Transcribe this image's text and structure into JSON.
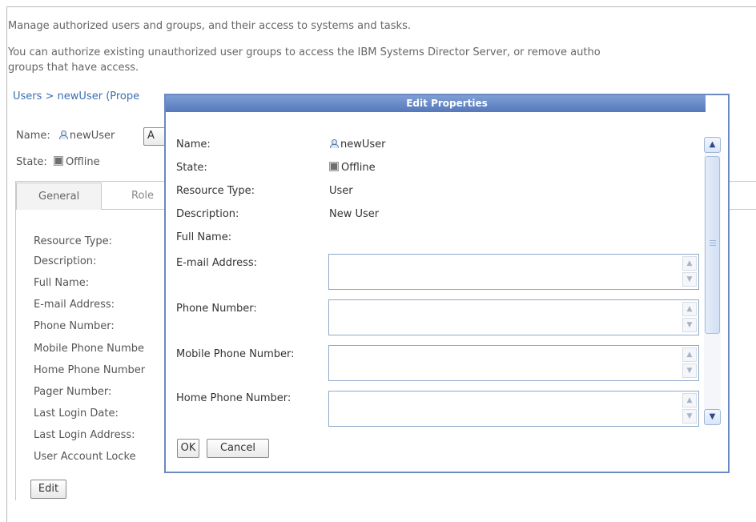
{
  "intro": {
    "line1": "Manage authorized users and groups, and their access to systems and tasks.",
    "line2": "You can authorize existing unauthorized user groups to access the IBM Systems Director Server, or remove autho",
    "line3": "groups that have access."
  },
  "breadcrumb": "Users > newUser (Prope",
  "header": {
    "name_label": "Name:",
    "name_value": "newUser",
    "action_button_fragment": "A",
    "state_label": "State:",
    "state_value": "Offline"
  },
  "tabs": [
    {
      "label": "General"
    },
    {
      "label": "Role"
    }
  ],
  "general_labels": [
    "Resource Type:",
    "Description:",
    "Full Name:",
    "E-mail Address:",
    "Phone Number:",
    "Mobile Phone Numbe",
    "Home Phone Number",
    "Pager Number:",
    "Last Login Date:",
    "Last Login Address:",
    "User Account Locke"
  ],
  "edit_button": "Edit",
  "dialog": {
    "title": "Edit Properties",
    "fields": [
      {
        "label": "Name:",
        "value": "newUser"
      },
      {
        "label": "State:",
        "value": "Offline"
      },
      {
        "label": "Resource Type:",
        "value": "User"
      },
      {
        "label": "Description:",
        "value": "New User"
      },
      {
        "label": "Full Name:",
        "value": ""
      }
    ],
    "inputs": [
      {
        "label": "E-mail Address:",
        "value": ""
      },
      {
        "label": "Phone Number:",
        "value": ""
      },
      {
        "label": "Mobile Phone Number:",
        "value": ""
      },
      {
        "label": "Home Phone Number:",
        "value": ""
      }
    ],
    "ok_button": "OK",
    "cancel_button": "Cancel"
  }
}
